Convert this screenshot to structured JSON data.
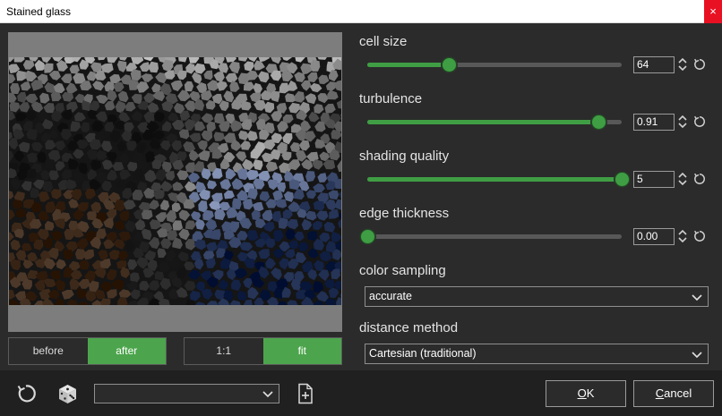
{
  "window": {
    "title": "Stained glass",
    "close_glyph": "×"
  },
  "preview": {
    "toggle_view": {
      "before": "before",
      "after": "after",
      "active": "after"
    },
    "toggle_zoom": {
      "one_to_one": "1:1",
      "fit": "fit",
      "active": "fit"
    }
  },
  "params": {
    "cell_size": {
      "label": "cell size",
      "value": "64",
      "fraction": 0.32
    },
    "turbulence": {
      "label": "turbulence",
      "value": "0.91",
      "fraction": 0.91
    },
    "shading_quality": {
      "label": "shading quality",
      "value": "5",
      "fraction": 1.0
    },
    "edge_thickness": {
      "label": "edge thickness",
      "value": "0.00",
      "fraction": 0.0
    },
    "color_sampling": {
      "label": "color sampling",
      "value": "accurate"
    },
    "distance_method": {
      "label": "distance method",
      "value": "Cartesian (traditional)"
    }
  },
  "bottom": {
    "preset_value": "",
    "ok_label": "OK",
    "ok_mnemonic": "O",
    "ok_rest": "K",
    "cancel_label": "Cancel",
    "cancel_mnemonic": "C",
    "cancel_rest": "ancel",
    "icons": [
      "reset-all-icon",
      "dice-icon",
      "new-preset-icon"
    ]
  },
  "colors": {
    "accent": "#3f9e44",
    "toggle_active": "#4ca54c",
    "background": "#2b2b2b",
    "bottom_bar": "#202020"
  }
}
